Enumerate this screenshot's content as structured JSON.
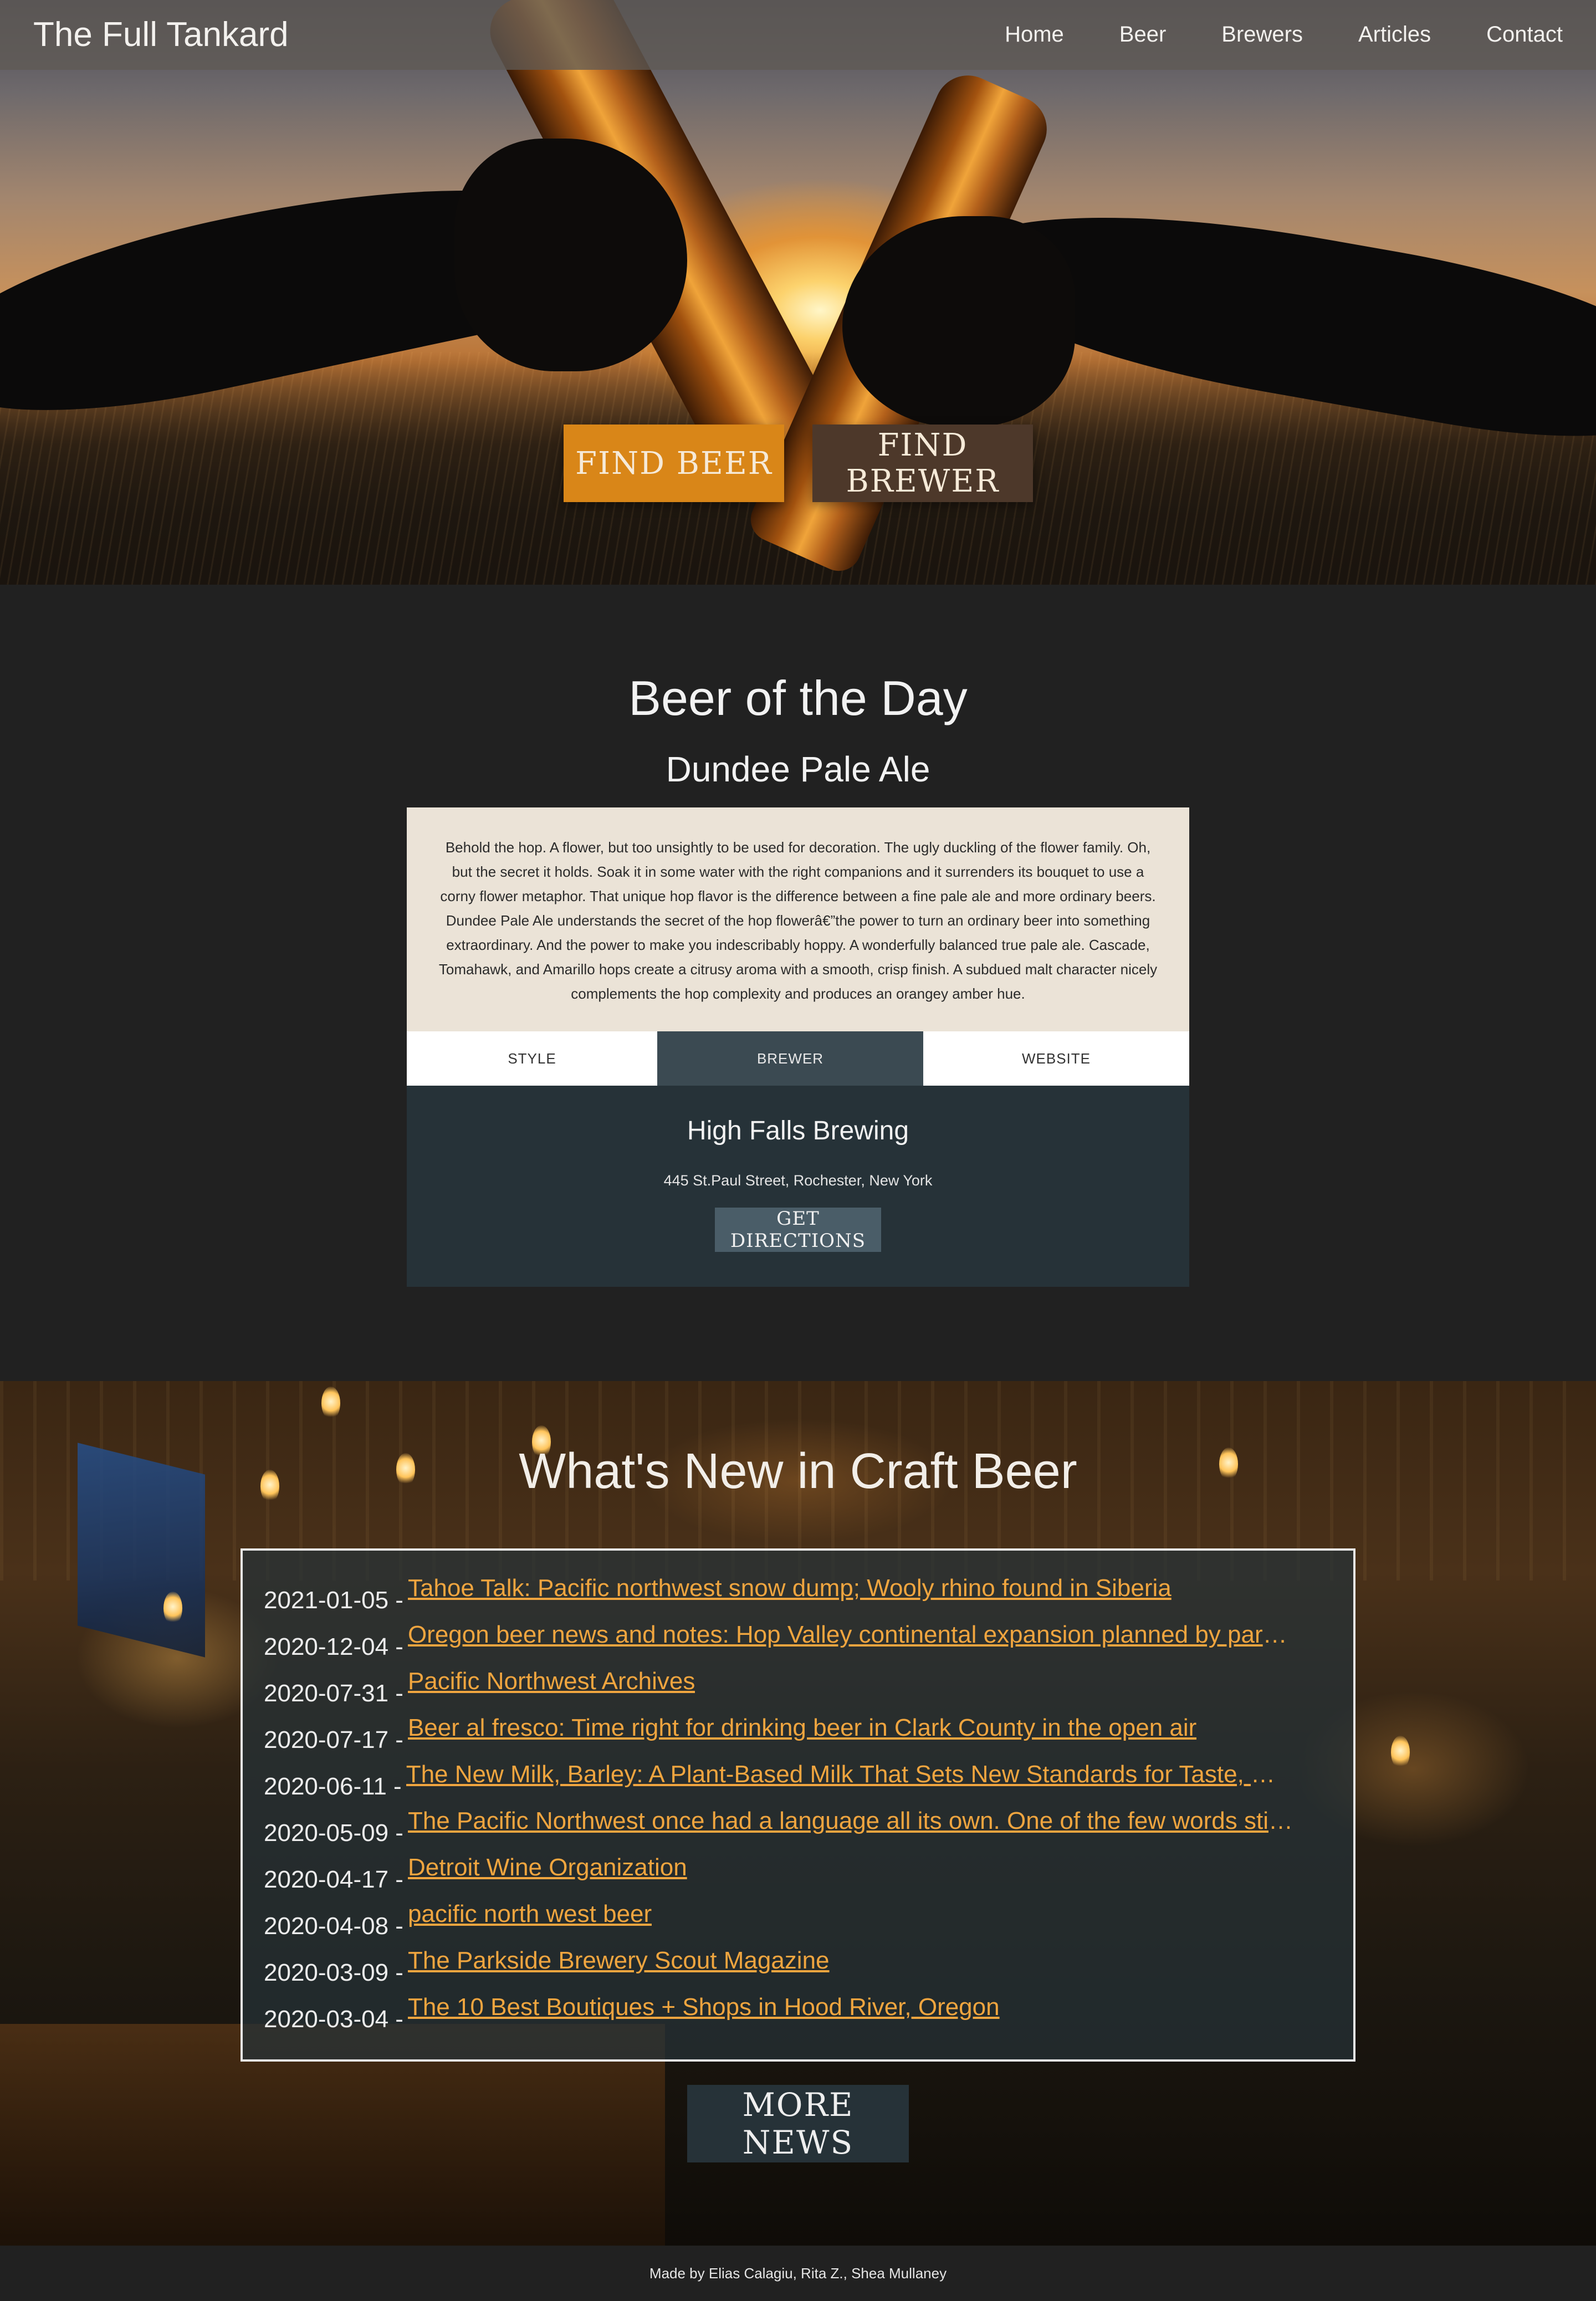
{
  "nav": {
    "brand": "The Full Tankard",
    "links": [
      "Home",
      "Beer",
      "Brewers",
      "Articles",
      "Contact"
    ]
  },
  "hero": {
    "find_beer": "FIND BEER",
    "find_brewer": "FIND BREWER"
  },
  "beer_of_the_day": {
    "heading": "Beer of the Day",
    "name": "Dundee Pale Ale",
    "description": "Behold the hop. A flower, but too unsightly to be used for decoration. The ugly duckling of the flower family. Oh, but the secret it holds. Soak it in some water with the right companions and it surrenders its bouquet to use a corny flower metaphor. That unique hop flavor is the difference between a fine pale ale and more ordinary beers. Dundee Pale Ale understands the secret of the hop flowerâ€”the power to turn an ordinary beer into something extraordinary. And the power to make you indescribably hoppy. A wonderfully balanced true pale ale. Cascade, Tomahawk, and Amarillo hops create a citrusy aroma with a smooth, crisp finish. A subdued malt character nicely complements the hop complexity and produces an orangey amber hue.",
    "tabs": [
      "STYLE",
      "BREWER",
      "WEBSITE"
    ],
    "active_tab": "BREWER",
    "brewer": {
      "name": "High Falls Brewing",
      "address": "445 St.Paul Street, Rochester, New York",
      "directions_label": "GET DIRECTIONS"
    }
  },
  "news": {
    "heading": "What's New in Craft Beer",
    "items": [
      {
        "date": "2021-01-05 -",
        "title": "Tahoe Talk: Pacific northwest snow dump; Wooly rhino found in Siberia"
      },
      {
        "date": "2020-12-04 -",
        "title": "Oregon beer news and notes: Hop Valley continental expansion planned by parent Molson Co..."
      },
      {
        "date": "2020-07-31 -",
        "title": "Pacific Northwest Archives"
      },
      {
        "date": "2020-07-17 -",
        "title": "Beer al fresco: Time right for drinking beer in Clark County in the open air"
      },
      {
        "date": "2020-06-11 -",
        "title": "The New Milk, Barley: A Plant-Based Milk That Sets New Standards for Taste, Nutrition, and ..."
      },
      {
        "date": "2020-05-09 -",
        "title": "The Pacific Northwest once had a language all its own. One of the few words still in use is ..."
      },
      {
        "date": "2020-04-17 -",
        "title": "Detroit Wine Organization"
      },
      {
        "date": "2020-04-08 -",
        "title": "pacific north west beer"
      },
      {
        "date": "2020-03-09 -",
        "title": "The Parkside Brewery Scout Magazine"
      },
      {
        "date": "2020-03-04 -",
        "title": "The 10 Best Boutiques + Shops in Hood River, Oregon"
      }
    ],
    "more_label": "MORE NEWS"
  },
  "footer": {
    "credits": "Made by Elias Calagiu, Rita Z., Shea Mullaney"
  },
  "colors": {
    "accent_orange": "#d98618",
    "link_orange": "#f0a53f",
    "dark_slate": "#263238",
    "page_bg": "#212121"
  }
}
